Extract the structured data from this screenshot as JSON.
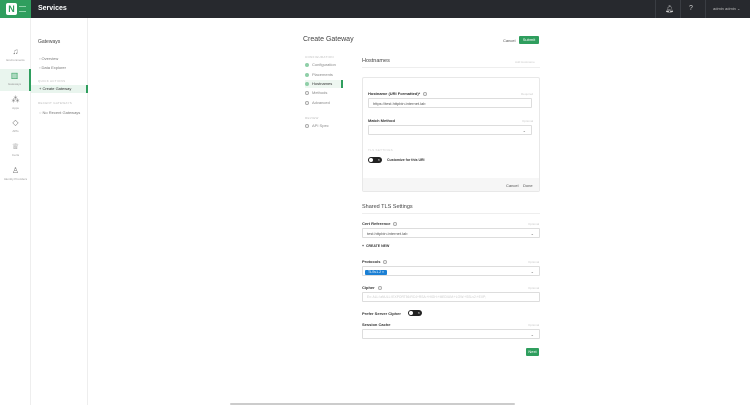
{
  "header": {
    "app_title": "Services",
    "user": "admin admin",
    "icons": [
      "bell-icon",
      "help-icon",
      "chevron-down-icon"
    ]
  },
  "rail": [
    {
      "label": "Environments",
      "icon": "bell-icon"
    },
    {
      "label": "Gateways",
      "icon": "grid-icon"
    },
    {
      "label": "Apps",
      "icon": "apps-icon"
    },
    {
      "label": "APIs",
      "icon": "api-icon"
    },
    {
      "label": "Certs",
      "icon": "cert-icon"
    },
    {
      "label": "Identity Providers",
      "icon": "identity-icon"
    }
  ],
  "subnav": {
    "title": "Gateways",
    "items": [
      "Overview",
      "Data Explorer"
    ],
    "quick_actions_label": "QUICK ACTIONS",
    "quick_action": "Create Gateway",
    "recent_label": "RECENT GATEWAYS",
    "recent_item": "No Recent Gateways"
  },
  "page": {
    "title": "Create Gateway",
    "cancel": "Cancel",
    "submit": "Submit"
  },
  "steps": {
    "config_label": "CONFIGURATION",
    "items": [
      "Configuration",
      "Placements",
      "Hostnames",
      "Methods",
      "Advanced"
    ],
    "review_label": "REVIEW",
    "review_item": "API Spec"
  },
  "hostnames": {
    "title": "Hostnames",
    "add": "Add Hostname",
    "hostname_label": "Hostname (URI Formatted)",
    "required": "Required",
    "hostname_value": "https://test.httpbin.internet.lab",
    "match_label": "Match Method",
    "optional": "Optional",
    "tls_label": "TLS SETTINGS",
    "customize": "Customize for this URI",
    "cancel": "Cancel",
    "done": "Done"
  },
  "shared": {
    "title": "Shared TLS Settings",
    "cert_label": "Cert Reference",
    "optional": "Optional",
    "cert_value": "test.httpbin.internet.lab",
    "create_new": "CREATE NEW",
    "protocols_label": "Protocols",
    "protocol_tag": "TLSv1.2",
    "cipher_label": "Cipher",
    "cipher_placeholder": "Ex: ALL:!aNULL:!EXPORT56:RC4+RSA:+HIGH:+MEDIUM:+LOW:+SSLv2:+EXP;",
    "prefer_label": "Prefer Server Cipher",
    "session_label": "Session Cache",
    "next": "Next"
  },
  "colors": {
    "brand": "#2f9e5e",
    "topbar": "#27292e",
    "tag": "#1a7fd4"
  }
}
